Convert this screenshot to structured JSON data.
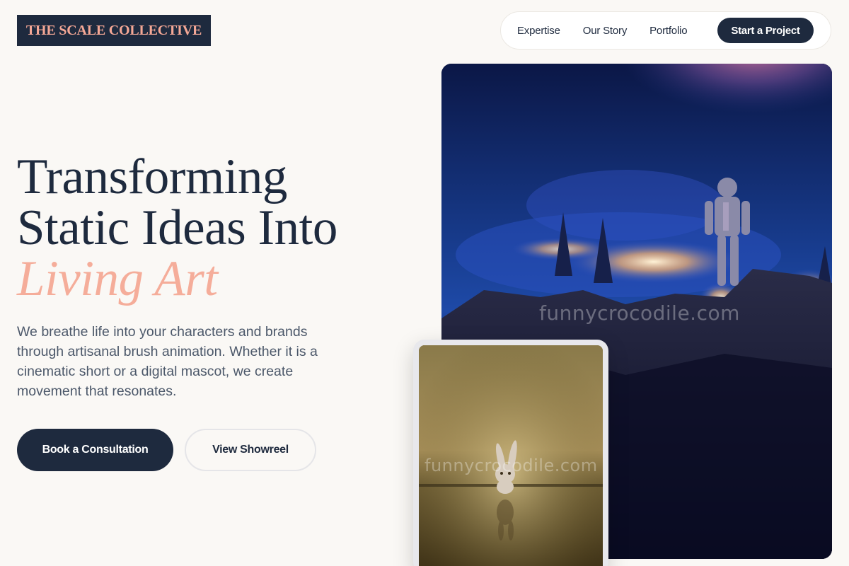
{
  "brand": {
    "logo_text": "THE SCALE COLLECTIVE"
  },
  "nav": {
    "links": [
      "Expertise",
      "Our Story",
      "Portfolio"
    ],
    "cta": "Start a Project"
  },
  "hero": {
    "headline_line1": "Transforming",
    "headline_line2": "Static Ideas Into",
    "headline_accent": "Living Art",
    "lead": "We breathe life into your characters and brands through artisanal brush animation. Whether it is a cinematic short or a digital mascot, we create movement that resonates.",
    "primary_button": "Book a Consultation",
    "secondary_button": "View Showreel"
  },
  "images": {
    "main_watermark": "funnycrocodile.com",
    "card_watermark": "funnycrocodile.com"
  },
  "colors": {
    "navy": "#1e2a3e",
    "accent_peach": "#f5ad9a",
    "background": "#faf8f5"
  }
}
